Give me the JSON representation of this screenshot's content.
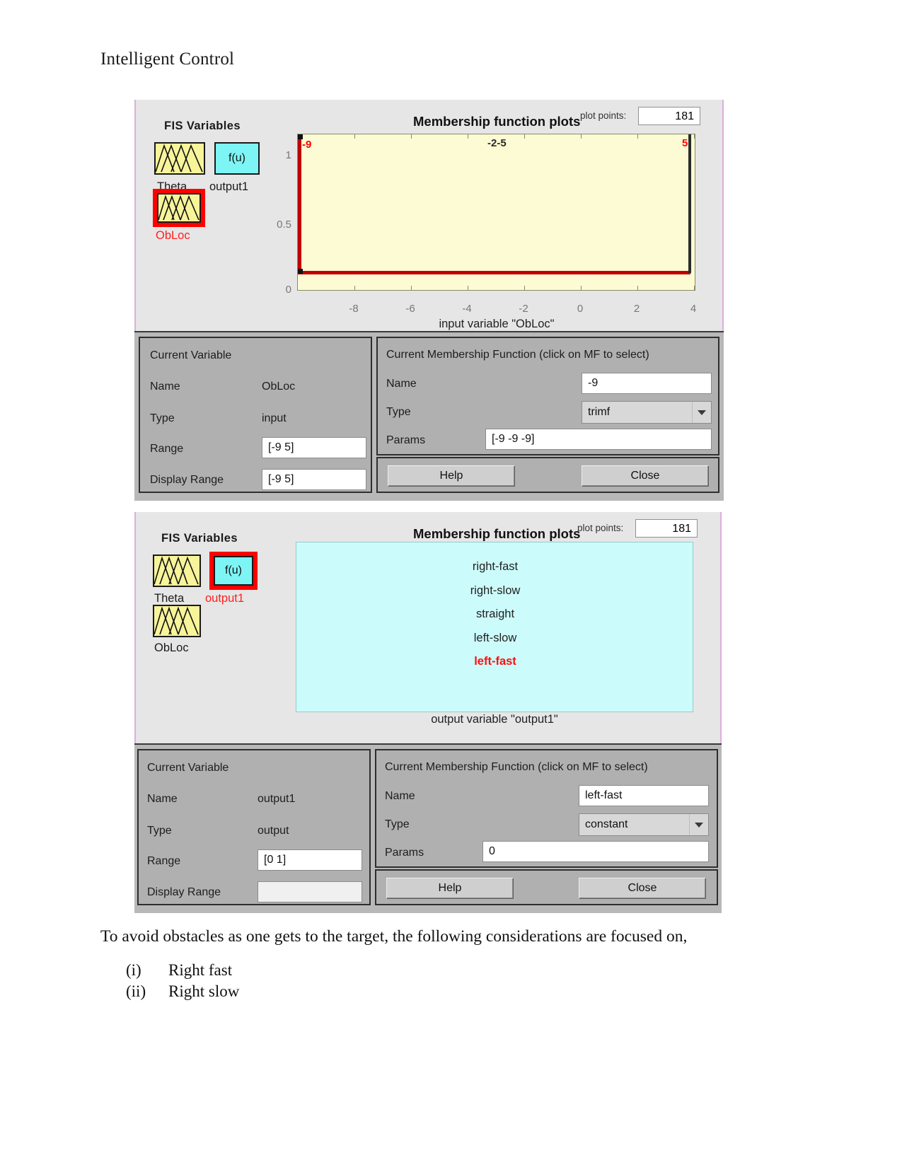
{
  "document": {
    "heading": "Intelligent Control",
    "paragraph": "To avoid obstacles as one gets to the target, the following considerations are focused on,",
    "list": [
      {
        "marker": "(i)",
        "text": "Right fast"
      },
      {
        "marker": "(ii)",
        "text": "Right slow"
      }
    ]
  },
  "colors": {
    "accent_red": "#ff0000",
    "input_swatch": "#f7f49a",
    "output_swatch": "#7ef5f5",
    "plot_bg_input": "#fcfbd4",
    "plot_bg_output": "#ccfbfb",
    "window_bg": "#e6e6e6",
    "panel_bg": "#b0b0b0"
  },
  "window_input": {
    "fis_variables_title": "FIS Variables",
    "variables": [
      {
        "name": "Theta",
        "kind": "input",
        "icon": "mf-curves-icon",
        "selected": false
      },
      {
        "name": "output1",
        "kind": "output",
        "icon": "f(u)",
        "selected": false
      },
      {
        "name": "ObLoc",
        "kind": "input",
        "icon": "mf-curves-icon",
        "selected": true
      }
    ],
    "plot": {
      "title": "Membership function plots",
      "plot_points_label": "plot points:",
      "plot_points_value": "181",
      "y_ticks": [
        "1",
        "0.5",
        "0"
      ],
      "x_ticks": [
        "-8",
        "-6",
        "-4",
        "-2",
        "0",
        "2",
        "4"
      ],
      "caption": "input variable \"ObLoc\"",
      "mf_labels": [
        {
          "text": "-9",
          "color": "red"
        },
        {
          "text": "-2-5",
          "color": "dark"
        },
        {
          "text": "5",
          "color": "red"
        }
      ]
    },
    "current_variable": {
      "title": "Current Variable",
      "name_label": "Name",
      "name_value": "ObLoc",
      "type_label": "Type",
      "type_value": "input",
      "range_label": "Range",
      "range_value": "[-9 5]",
      "display_range_label": "Display Range",
      "display_range_value": "[-9 5]"
    },
    "current_mf": {
      "title": "Current Membership Function (click on MF to select)",
      "name_label": "Name",
      "name_value": "-9",
      "type_label": "Type",
      "type_value": "trimf",
      "params_label": "Params",
      "params_value": "[-9 -9 -9]"
    },
    "buttons": {
      "help": "Help",
      "close": "Close"
    }
  },
  "window_output": {
    "fis_variables_title": "FIS Variables",
    "variables": [
      {
        "name": "Theta",
        "kind": "input",
        "icon": "mf-curves-icon",
        "selected": false
      },
      {
        "name": "output1",
        "kind": "output",
        "icon": "f(u)",
        "selected": true
      },
      {
        "name": "ObLoc",
        "kind": "input",
        "icon": "mf-curves-icon",
        "selected": false
      }
    ],
    "plot": {
      "title": "Membership function plots",
      "plot_points_label": "plot points:",
      "plot_points_value": "181",
      "caption": "output variable \"output1\"",
      "mf_list": [
        {
          "text": "right-fast",
          "selected": false
        },
        {
          "text": "right-slow",
          "selected": false
        },
        {
          "text": "straight",
          "selected": false
        },
        {
          "text": "left-slow",
          "selected": false
        },
        {
          "text": "left-fast",
          "selected": true
        }
      ]
    },
    "current_variable": {
      "title": "Current Variable",
      "name_label": "Name",
      "name_value": "output1",
      "type_label": "Type",
      "type_value": "output",
      "range_label": "Range",
      "range_value": "[0 1]",
      "display_range_label": "Display Range",
      "display_range_value": ""
    },
    "current_mf": {
      "title": "Current Membership Function (click on MF to select)",
      "name_label": "Name",
      "name_value": "left-fast",
      "type_label": "Type",
      "type_value": "constant",
      "params_label": "Params",
      "params_value": "0"
    },
    "buttons": {
      "help": "Help",
      "close": "Close"
    }
  }
}
